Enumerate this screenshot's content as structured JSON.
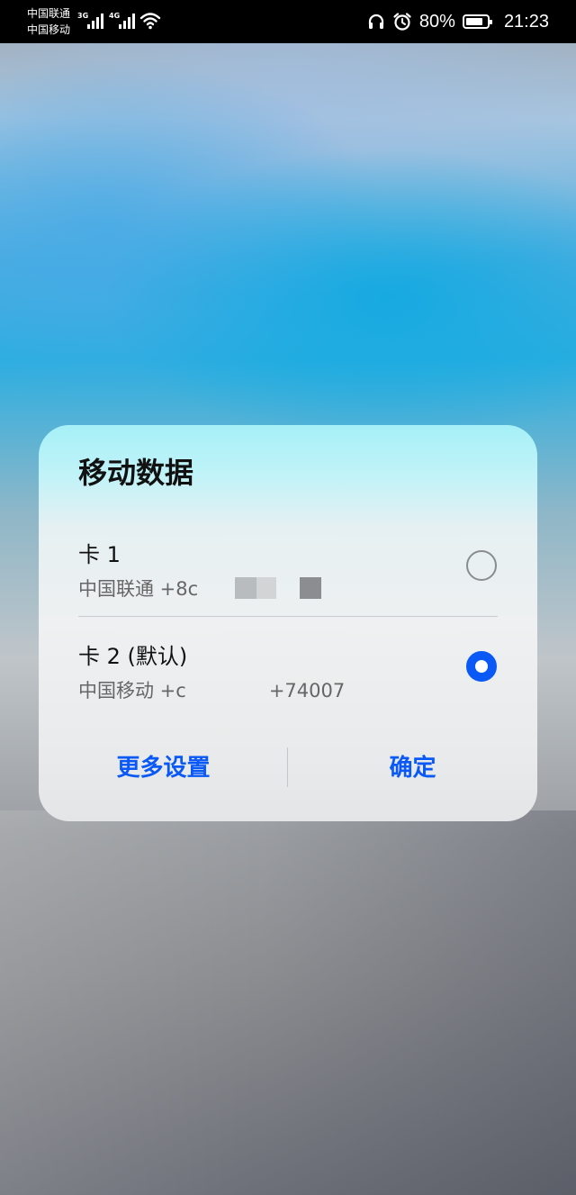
{
  "status_bar": {
    "carrier_1": "中国联通",
    "carrier_2": "中国移动",
    "network_1": "3G",
    "network_2": "4G",
    "battery_percent": "80%",
    "battery_level": 0.8,
    "time": "21:23",
    "icons": [
      "signal-icon",
      "wifi-icon",
      "headphones-icon",
      "alarm-icon",
      "battery-icon"
    ]
  },
  "dialog": {
    "title": "移动数据",
    "options": [
      {
        "name": "卡 1",
        "carrier_number": "中国联通 +8c",
        "selected": false
      },
      {
        "name": "卡 2 (默认)",
        "carrier_number_prefix": "中国移动 +c",
        "carrier_number_suffix": "+74007",
        "selected": true
      }
    ],
    "buttons": {
      "more_settings": "更多设置",
      "confirm": "确定"
    },
    "accent_color": "#0a59f7"
  }
}
